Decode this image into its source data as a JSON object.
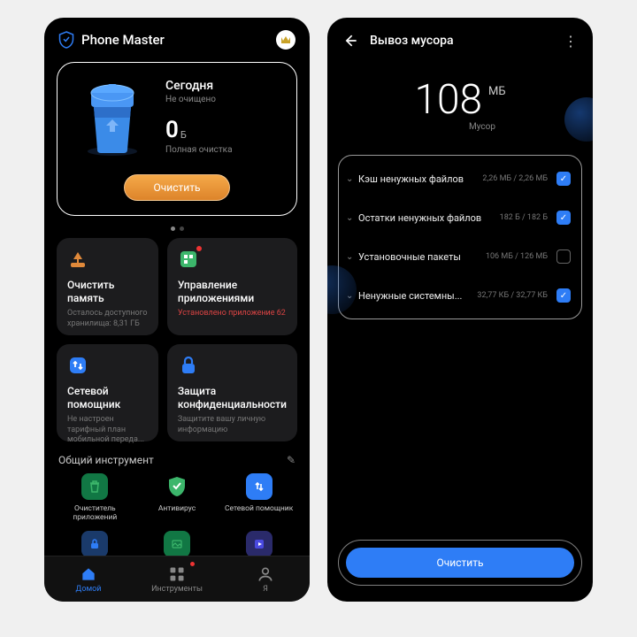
{
  "left": {
    "app_title": "Phone Master",
    "hero": {
      "today": "Сегодня",
      "not_cleaned": "Не очищено",
      "zero_value": "0",
      "zero_unit": "Б",
      "full_clean": "Полная очистка",
      "clean_btn": "Очистить"
    },
    "cards": [
      {
        "title": "Очистить память",
        "sub": "Осталось доступного хранилища: 8,31 ГБ"
      },
      {
        "title": "Управление приложениями",
        "red": "Установлено приложение 62"
      },
      {
        "title": "Сетевой помощник",
        "sub": "Не настроен тарифный план мобильной переда..."
      },
      {
        "title": "Защита конфиденциальности",
        "sub": "Защитите вашу личную информацию"
      }
    ],
    "section_title": "Общий инструмент",
    "tools": [
      {
        "label": "Очиститель приложений",
        "color": "#3cb66b"
      },
      {
        "label": "Антивирус",
        "color": "#3cb66b"
      },
      {
        "label": "Сетевой помощник",
        "color": "#2e7df6"
      }
    ],
    "nav": [
      {
        "label": "Домой"
      },
      {
        "label": "Инструменты"
      },
      {
        "label": "Я"
      }
    ]
  },
  "right": {
    "title": "Вывоз мусора",
    "value": "108",
    "unit": "МБ",
    "sub": "Мусор",
    "rows": [
      {
        "label": "Кэш ненужных файлов",
        "size": "2,26 МБ / 2,26 МБ",
        "checked": true
      },
      {
        "label": "Остатки ненужных файлов",
        "size": "182 Б / 182 Б",
        "checked": true
      },
      {
        "label": "Установочные пакеты",
        "size": "106 МБ / 126 МБ",
        "checked": false
      },
      {
        "label": "Ненужные системны...",
        "size": "32,77 КБ / 32,77 КБ",
        "checked": true
      }
    ],
    "clean_btn": "Очистить"
  }
}
